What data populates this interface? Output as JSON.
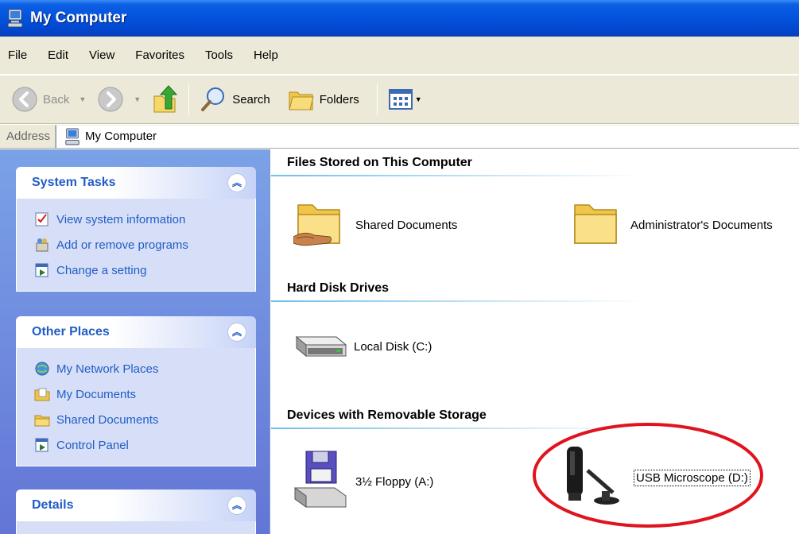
{
  "window": {
    "title": "My Computer",
    "icon": "my-computer-icon"
  },
  "menu": [
    "File",
    "Edit",
    "View",
    "Favorites",
    "Tools",
    "Help"
  ],
  "toolbar": {
    "back_label": "Back",
    "search_label": "Search",
    "folders_label": "Folders"
  },
  "address": {
    "label": "Address",
    "value": "My Computer"
  },
  "task_pane": {
    "system_tasks": {
      "title": "System Tasks",
      "items": [
        {
          "label": "View system information",
          "icon": "system-info-icon"
        },
        {
          "label": "Add or remove programs",
          "icon": "add-remove-programs-icon"
        },
        {
          "label": "Change a setting",
          "icon": "control-panel-icon"
        }
      ]
    },
    "other_places": {
      "title": "Other Places",
      "items": [
        {
          "label": "My Network Places",
          "icon": "network-places-icon"
        },
        {
          "label": "My Documents",
          "icon": "my-documents-icon"
        },
        {
          "label": "Shared Documents",
          "icon": "shared-folder-icon"
        },
        {
          "label": "Control Panel",
          "icon": "control-panel-icon"
        }
      ]
    },
    "details": {
      "title": "Details"
    }
  },
  "content": {
    "groups": [
      {
        "title": "Files Stored on This Computer",
        "items": [
          {
            "label": "Shared Documents",
            "icon": "shared-folder-icon"
          },
          {
            "label": "Administrator's Documents",
            "icon": "folder-icon"
          }
        ]
      },
      {
        "title": "Hard Disk Drives",
        "items": [
          {
            "label": "Local Disk (C:)",
            "icon": "hard-disk-icon"
          }
        ]
      },
      {
        "title": "Devices with Removable Storage",
        "items": [
          {
            "label": "3½ Floppy (A:)",
            "icon": "floppy-drive-icon"
          },
          {
            "label": "USB Microscope (D:)",
            "icon": "usb-microscope-icon"
          }
        ]
      }
    ]
  },
  "colors": {
    "title_bar": "#0454de",
    "task_pane_bg": "#7ba2e7",
    "link_blue": "#215dc6",
    "highlight_ring": "#e0141e"
  }
}
